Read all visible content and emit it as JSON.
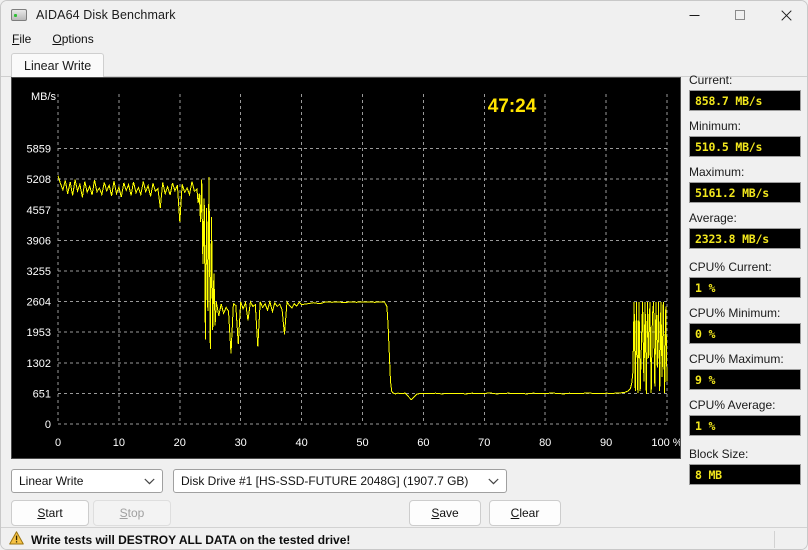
{
  "window": {
    "title": "AIDA64 Disk Benchmark",
    "icon": "disk-drive-icon",
    "minimize": "—",
    "maximize": "□",
    "close": "✕"
  },
  "menu": [
    {
      "label": "File",
      "accel": "F",
      "rest": "ile"
    },
    {
      "label": "Options",
      "accel": "O",
      "rest": "ptions"
    }
  ],
  "tabs": [
    {
      "label": "Linear Write",
      "selected": true
    }
  ],
  "chart_data": {
    "type": "line",
    "title": "",
    "timer": "47:24",
    "xlabel": "%",
    "ylabel": "MB/s",
    "xlim": [
      0,
      100
    ],
    "ylim": [
      0,
      6510
    ],
    "grid": true,
    "line_color": "#ffff00",
    "background": "#000000",
    "grid_color": "#9a9a9a",
    "axis_text_color": "#ffffff",
    "yticks": [
      0,
      651,
      1302,
      1953,
      2604,
      3255,
      3906,
      4557,
      5208,
      5859
    ],
    "ytick_labels": [
      "0",
      "651",
      "1302",
      "1953",
      "2604",
      "3255",
      "3906",
      "4557",
      "5208",
      "5859"
    ],
    "xticks": [
      0,
      10,
      20,
      30,
      40,
      50,
      60,
      70,
      80,
      90,
      100
    ],
    "xtick_labels": [
      "0",
      "10",
      "20",
      "30",
      "40",
      "50",
      "60",
      "70",
      "80",
      "90",
      "100 %"
    ],
    "series": [
      {
        "name": "Linear Write",
        "color": "#ffff00",
        "description": "Write throughput vs drive position; SLC cache ~5100 MB/s to 24%, folding plateau ~2600 MB/s to 54%, native ~650 MB/s to 94%, then oscillating spikes to end.",
        "x": [
          0.0,
          0.4,
          0.8,
          1.2,
          1.6,
          2.0,
          2.4,
          2.8,
          3.2,
          3.6,
          4.0,
          4.4,
          4.8,
          5.2,
          5.6,
          6.0,
          6.4,
          6.8,
          7.2,
          7.6,
          8.0,
          8.4,
          8.8,
          9.2,
          9.6,
          10.0,
          10.4,
          10.8,
          11.2,
          11.6,
          12.0,
          12.4,
          12.8,
          13.2,
          13.6,
          14.0,
          14.4,
          14.8,
          15.2,
          15.6,
          16.0,
          16.4,
          16.8,
          17.2,
          17.6,
          18.0,
          18.4,
          18.8,
          19.2,
          19.6,
          20.0,
          20.4,
          20.8,
          21.2,
          21.6,
          22.0,
          22.4,
          22.8,
          23.0,
          23.2,
          23.4,
          23.6,
          23.8,
          24.0,
          24.2,
          24.4,
          24.6,
          24.8,
          25.0,
          25.2,
          25.4,
          25.6,
          25.8,
          26.0,
          26.4,
          26.8,
          27.2,
          27.6,
          28.0,
          28.4,
          28.8,
          29.2,
          29.6,
          30.0,
          30.4,
          30.8,
          31.2,
          31.6,
          32.0,
          32.4,
          32.8,
          33.2,
          33.6,
          34.0,
          34.4,
          34.8,
          35.2,
          35.6,
          36.0,
          36.4,
          36.8,
          37.2,
          37.6,
          38.0,
          38.4,
          38.8,
          39.2,
          39.6,
          40.0,
          41.0,
          42.0,
          43.0,
          44.0,
          45.0,
          46.0,
          47.0,
          48.0,
          49.0,
          50.0,
          51.0,
          52.0,
          53.0,
          53.6,
          54.0,
          54.2,
          54.4,
          54.6,
          54.8,
          55.0,
          55.4,
          55.8,
          56.2,
          56.6,
          57.0,
          58.0,
          59.0,
          60.0,
          61.0,
          62.0,
          63.0,
          64.0,
          65.0,
          66.0,
          67.0,
          68.0,
          69.0,
          70.0,
          71.0,
          72.0,
          73.0,
          74.0,
          75.0,
          76.0,
          77.0,
          78.0,
          79.0,
          80.0,
          81.0,
          82.0,
          83.0,
          84.0,
          85.0,
          86.0,
          87.0,
          88.0,
          89.0,
          90.0,
          91.0,
          92.0,
          93.0,
          93.6,
          94.0,
          94.2,
          94.4,
          94.6,
          94.8,
          95.0,
          95.2,
          95.4,
          95.6,
          95.8,
          96.0,
          96.2,
          96.4,
          96.6,
          96.8,
          97.0,
          97.2,
          97.4,
          97.6,
          97.8,
          98.0,
          98.2,
          98.4,
          98.6,
          98.8,
          99.0,
          99.2,
          99.4,
          99.6,
          99.8,
          100.0
        ],
        "y": [
          5280,
          5120,
          4980,
          5180,
          4900,
          5150,
          4860,
          5200,
          4950,
          5100,
          4820,
          5160,
          4930,
          5060,
          4870,
          5190,
          4940,
          5020,
          4880,
          5140,
          4960,
          5080,
          4850,
          5170,
          4900,
          5040,
          4830,
          5130,
          4970,
          5090,
          4860,
          5150,
          4920,
          5030,
          4880,
          5160,
          4940,
          5070,
          4840,
          5120,
          4950,
          5010,
          4600,
          5140,
          4900,
          5050,
          4870,
          5130,
          4960,
          5080,
          4300,
          5100,
          4930,
          5020,
          4880,
          5160,
          4950,
          5000,
          4700,
          4900,
          4300,
          5200,
          3400,
          4800,
          1800,
          4600,
          2400,
          5250,
          1600,
          4400,
          2000,
          3200,
          2100,
          2600,
          2300,
          2550,
          2350,
          2480,
          2400,
          1500,
          2560,
          2520,
          1700,
          2600,
          2450,
          2580,
          2200,
          2600,
          2500,
          2540,
          1650,
          2600,
          2480,
          2560,
          2420,
          2600,
          2390,
          2580,
          2500,
          2550,
          2430,
          1900,
          2600,
          2520,
          2470,
          2560,
          2510,
          2590,
          2540,
          2560,
          2580,
          2560,
          2600,
          2590,
          2600,
          2580,
          2600,
          2590,
          2600,
          2600,
          2590,
          2600,
          2600,
          2500,
          2100,
          1500,
          900,
          700,
          660,
          640,
          655,
          650,
          645,
          660,
          520,
          640,
          650,
          645,
          655,
          640,
          650,
          648,
          652,
          640,
          655,
          645,
          650,
          660,
          640,
          650,
          655,
          645,
          650,
          640,
          655,
          650,
          645,
          660,
          650,
          640,
          655,
          645,
          650,
          660,
          650,
          645,
          655,
          650,
          660,
          670,
          700,
          760,
          860,
          1100,
          2600,
          700,
          2600,
          660,
          2600,
          700,
          1700,
          2600,
          900,
          2600,
          640,
          2600,
          1400,
          2600,
          660,
          2300,
          2600,
          800,
          2600,
          1200,
          2600,
          700,
          2600,
          1000,
          2600,
          660,
          2500,
          900
        ]
      }
    ]
  },
  "sidebar": {
    "stats": [
      {
        "label": "Current:",
        "value": "858.7 MB/s",
        "gap": false
      },
      {
        "label": "Minimum:",
        "value": "510.5 MB/s",
        "gap": false
      },
      {
        "label": "Maximum:",
        "value": "5161.2 MB/s",
        "gap": false
      },
      {
        "label": "Average:",
        "value": "2323.8 MB/s",
        "gap": false
      },
      {
        "label": "CPU% Current:",
        "value": "1 %",
        "gap": true
      },
      {
        "label": "CPU% Minimum:",
        "value": "0 %",
        "gap": false
      },
      {
        "label": "CPU% Maximum:",
        "value": "9 %",
        "gap": false
      },
      {
        "label": "CPU% Average:",
        "value": "1 %",
        "gap": false
      },
      {
        "label": "Block Size:",
        "value": "8 MB",
        "gap": true
      }
    ]
  },
  "controls": {
    "test_select": {
      "value": "Linear Write"
    },
    "drive_select": {
      "value": "Disk Drive #1  [HS-SSD-FUTURE 2048G]  (1907.7 GB)"
    },
    "buttons": {
      "start": {
        "accel": "S",
        "rest": "tart",
        "disabled": false
      },
      "stop": {
        "accel": "S",
        "rest": "top",
        "disabled": true
      },
      "save": {
        "accel": "S",
        "rest": "ave",
        "disabled": false
      },
      "clear": {
        "accel": "C",
        "rest": "lear",
        "disabled": false
      }
    }
  },
  "warning": {
    "icon": "warning-triangle-icon",
    "text": "Write tests will DESTROY ALL DATA on the tested drive!"
  }
}
